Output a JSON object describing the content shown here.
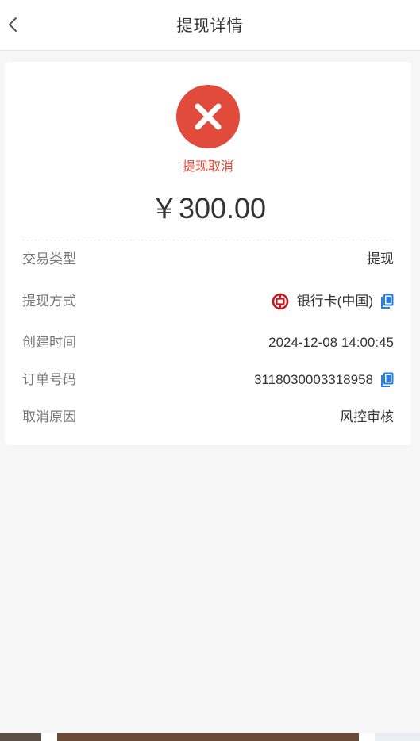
{
  "header": {
    "title": "提现详情",
    "back_icon": "chevron-left-icon"
  },
  "status": {
    "icon": "close-circle-icon",
    "text": "提现取消",
    "color": "#e14b3b"
  },
  "amount": "￥300.00",
  "details": {
    "type": {
      "label": "交易类型",
      "value": "提现"
    },
    "method": {
      "label": "提现方式",
      "value": "银行卡(中国)",
      "bank_icon": "bank-of-china-icon",
      "copy_icon": "copy-icon"
    },
    "created": {
      "label": "创建时间",
      "value": "2024-12-08 14:00:45"
    },
    "order": {
      "label": "订单号码",
      "value": "3118030003318958",
      "copy_icon": "copy-icon"
    },
    "reason": {
      "label": "取消原因",
      "value": "风控审核"
    }
  },
  "colors": {
    "accent_blue": "#1f7ff0",
    "error_red": "#e14b3b",
    "bank_red": "#c8161e",
    "background": "#f6f6f6"
  }
}
